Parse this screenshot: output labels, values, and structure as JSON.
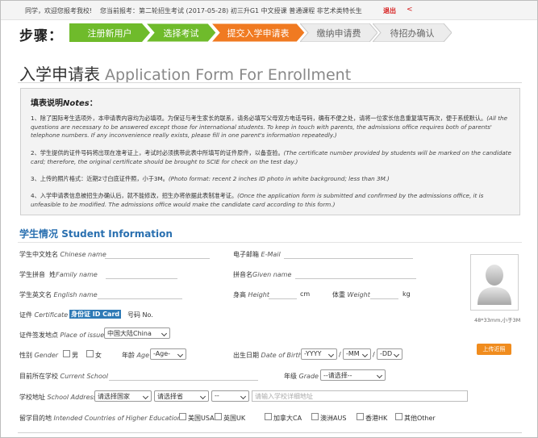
{
  "topbar": {
    "greeting": "同学，欢迎您报考我校!",
    "exam_info": "您当前报考：第二轮招生考试 (2017-05-28) 初三升G1 中文授课 普通课程 非艺术类特长生",
    "logout": "退出",
    "arrow": "<"
  },
  "steps": {
    "label": "步骤：",
    "items": [
      {
        "label": "注册新用户",
        "state": "done"
      },
      {
        "label": "选择考试",
        "state": "done"
      },
      {
        "label": "提交入学申请表",
        "state": "current"
      },
      {
        "label": "缴纳申请费",
        "state": "pending"
      },
      {
        "label": "待招办确认",
        "state": "pending"
      }
    ]
  },
  "colors": {
    "done": "#6fbb2b",
    "current": "#f07a21",
    "pending": "#ececec",
    "accent": "#2a70b0"
  },
  "page": {
    "title_cn": "入学申请表",
    "title_en": "Application Form For Enrollment"
  },
  "notes": {
    "title_cn": "填表说明",
    "title_en": "Notes",
    "title_colon": "：",
    "items": [
      {
        "cn": "1、除了国际考生选项外，本申请表内容均为必填项。为保证与考生家长的联系，请务必填写父母双方电话号码，确有不便之处，请将一位家长信息重复填写两次，便于系统默认。",
        "en": "(All the questions are necessary to be answered except those for international students. To keep in touch with parents, the admissions office requires both of parents' telephone numbers. If any inconvenience really exists, please fill in one parent's information repeatedly.)"
      },
      {
        "cn": "2、学生提供的证件号码将出现在准考证上，考试时必须携带此表中所填写的证件原件，以备查验。",
        "en": "(The certificate number provided by students will be marked on the candidate card; therefore, the original certificate should be brought to SCIE for check on the test day.)"
      },
      {
        "cn": "3、上传的照片格式：近期2寸白底证件照，小于3M。",
        "en": "(Photo format: recent 2 inches ID photo in white background; less than 3M.)"
      },
      {
        "cn": "4、入学申请表信息被招生办确认后，就不能修改，招生办将依据此表制准考证。",
        "en": "(Once the application form is submitted and confirmed by the admissions office, it is unfeasible to be modified. The admissions office would make the candidate card according to this form.)"
      }
    ]
  },
  "student": {
    "section_cn": "学生情况",
    "section_en": "Student Information",
    "chinese_name": {
      "cn": "学生中文姓名",
      "en": "Chinese name"
    },
    "email": {
      "cn": "电子邮箱",
      "en": "E-Mail"
    },
    "pinyin": {
      "cn": "学生拼音",
      "surname_cn": "姓",
      "surname_en": "Family name",
      "given_cn": "拼音名",
      "given_en": "Given name"
    },
    "english_name": {
      "cn": "学生英文名",
      "en": "English name"
    },
    "height": {
      "cn": "身高",
      "en": "Height",
      "unit": "cm"
    },
    "weight": {
      "cn": "体重",
      "en": "Weight",
      "unit": "kg"
    },
    "certificate": {
      "cn": "证件",
      "en": "Certificate",
      "type": "身份证 ID Card",
      "number_cn": "号码",
      "number_en": "No."
    },
    "issue_place": {
      "cn": "证件签发地点",
      "en": "Place of issue",
      "value": "中国大陆China"
    },
    "gender": {
      "cn": "性别",
      "en": "Gender",
      "male": "男",
      "female": "女"
    },
    "age": {
      "cn": "年龄",
      "en": "Age",
      "value": "-Age-"
    },
    "dob": {
      "cn": "出生日期",
      "en": "Date of Birth",
      "year": "-YYYY",
      "month": "-MM",
      "day": "-DD",
      "sep": "/"
    },
    "school": {
      "cn": "目前所在学校",
      "en": "Current School"
    },
    "grade": {
      "cn": "年级",
      "en": "Grade",
      "value": "--请选择--"
    },
    "address": {
      "cn": "学校地址",
      "en": "School Address",
      "country": "请选择国家",
      "province": "请选择省",
      "city": "--",
      "placeholder": "请输入学校详细地址"
    },
    "destination": {
      "cn": "留学目的地",
      "en": "Intended Countries of Higher Education",
      "options": [
        "美国USA",
        "英国UK",
        "加拿大CA",
        "澳洲AUS",
        "香港HK",
        "其他Other"
      ]
    },
    "photo": {
      "caption": "48*33mm,小于3M",
      "upload": "上传近照"
    }
  }
}
